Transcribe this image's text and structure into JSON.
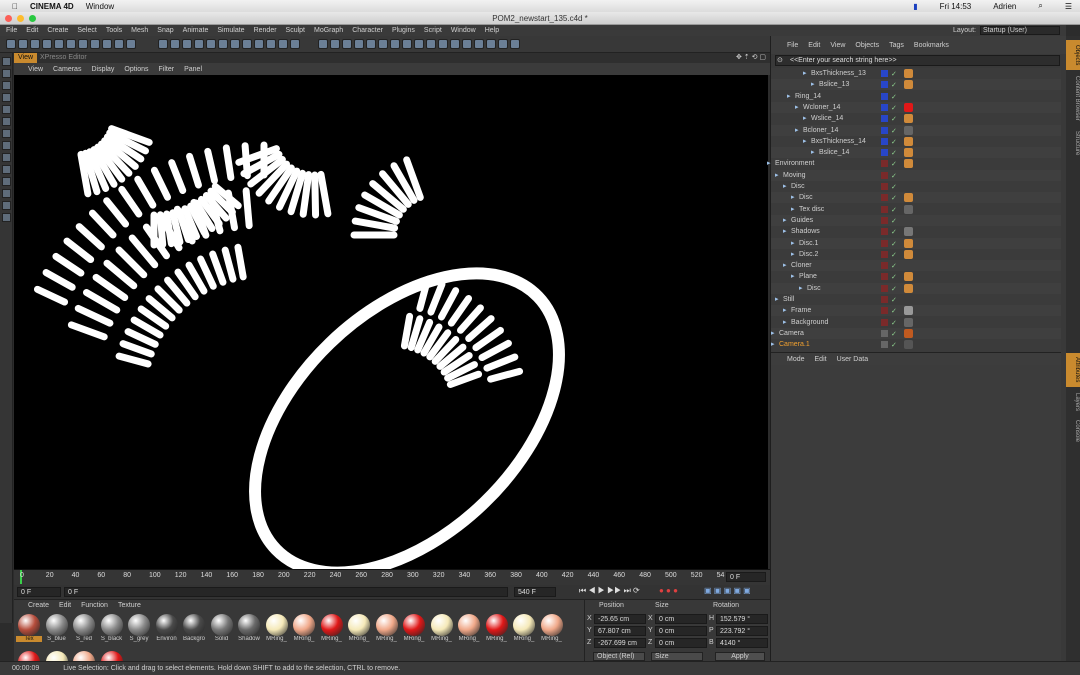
{
  "mac": {
    "app_name": "CINEMA 4D",
    "window_menu": "Window",
    "clock": "Fri 14:53",
    "user": "Adrien"
  },
  "window_title": "POM2_newstart_135.c4d *",
  "menu": [
    "File",
    "Edit",
    "Create",
    "Select",
    "Tools",
    "Mesh",
    "Snap",
    "Animate",
    "Simulate",
    "Render",
    "Sculpt",
    "MoGraph",
    "Character",
    "Plugins",
    "Script",
    "Window",
    "Help"
  ],
  "layout": {
    "label": "Layout:",
    "value": "Startup (User)"
  },
  "viewport_tabs": [
    "View",
    "XPresso Editor"
  ],
  "viewport_menu": [
    "View",
    "Cameras",
    "Display",
    "Options",
    "Filter",
    "Panel"
  ],
  "timeline": {
    "ticks": [
      "0",
      "20",
      "40",
      "60",
      "80",
      "100",
      "120",
      "140",
      "160",
      "180",
      "200",
      "220",
      "240",
      "260",
      "280",
      "300",
      "320",
      "340",
      "360",
      "380",
      "400",
      "420",
      "440",
      "460",
      "480",
      "500",
      "520",
      "54"
    ],
    "end_field": "0 F"
  },
  "time_controls": {
    "start": "0 F",
    "current": "0 F",
    "end1": "540 F",
    "end2": "540 F"
  },
  "material_menu": [
    "Create",
    "Edit",
    "Function",
    "Texture"
  ],
  "materials": [
    {
      "name": "Tex",
      "color": "#b64d3c"
    },
    {
      "name": "S_blue",
      "color": "#8a8a8a"
    },
    {
      "name": "S_red",
      "color": "#8a8a8a"
    },
    {
      "name": "S_black",
      "color": "#8a8a8a"
    },
    {
      "name": "S_grey",
      "color": "#8a8a8a"
    },
    {
      "name": "Environ",
      "color": "#4a4a4a"
    },
    {
      "name": "Backgro",
      "color": "#4a4a4a"
    },
    {
      "name": "Solid",
      "color": "#777777"
    },
    {
      "name": "Shadow",
      "color": "#6a6a6a"
    },
    {
      "name": "MRing_",
      "color": "#f5e9b8"
    },
    {
      "name": "MRing_",
      "color": "#f0a889"
    },
    {
      "name": "MRing_",
      "color": "#e01818"
    },
    {
      "name": "MRing_",
      "color": "#f5e9b8"
    },
    {
      "name": "MRing_",
      "color": "#f0a889"
    },
    {
      "name": "MRing_",
      "color": "#e01818"
    },
    {
      "name": "MRing_",
      "color": "#f5e9b8"
    },
    {
      "name": "MRing_",
      "color": "#f0a889"
    },
    {
      "name": "MRing_",
      "color": "#e01818"
    },
    {
      "name": "MRing_",
      "color": "#f5e9b8"
    },
    {
      "name": "MRing_",
      "color": "#f0a889"
    }
  ],
  "coords": {
    "headers": [
      "Position",
      "Size",
      "Rotation"
    ],
    "rows": [
      {
        "a": "X",
        "pos": "-25.65 cm",
        "b": "X",
        "size": "0 cm",
        "c": "H",
        "rot": "152.579 °"
      },
      {
        "a": "Y",
        "pos": "67.807 cm",
        "b": "Y",
        "size": "0 cm",
        "c": "P",
        "rot": "223.792 °"
      },
      {
        "a": "Z",
        "pos": "-267.699 cm",
        "b": "Z",
        "size": "0 cm",
        "c": "B",
        "rot": "4140 °"
      }
    ],
    "mode": "Object (Rel)",
    "size_mode": "Size",
    "apply": "Apply"
  },
  "object_menu": [
    "File",
    "Edit",
    "View",
    "Objects",
    "Tags",
    "Bookmarks"
  ],
  "search_placeholder": "<<Enter your search string here>>",
  "objects": [
    {
      "name": "BxsThickness_13",
      "color": "#2846c8"
    },
    {
      "name": "Bslice_13",
      "color": "#2846c8"
    },
    {
      "name": "Ring_14",
      "color": "#2846c8"
    },
    {
      "name": "Wcloner_14",
      "color": "#2846c8"
    },
    {
      "name": "Wslice_14",
      "color": "#2846c8"
    },
    {
      "name": "Bcloner_14",
      "color": "#2846c8"
    },
    {
      "name": "BxsThickness_14",
      "color": "#2846c8"
    },
    {
      "name": "Bslice_14",
      "color": "#2846c8"
    },
    {
      "name": "Environment",
      "color": "#7a2a2a"
    },
    {
      "name": "Moving",
      "color": "#7a2a2a"
    },
    {
      "name": "Disc",
      "color": "#7a2a2a"
    },
    {
      "name": "Disc",
      "color": "#7a2a2a"
    },
    {
      "name": "Tex disc",
      "color": "#7a2a2a"
    },
    {
      "name": "Guides",
      "color": "#7a2a2a"
    },
    {
      "name": "Shadows",
      "color": "#7a2a2a"
    },
    {
      "name": "Disc.1",
      "color": "#7a2a2a"
    },
    {
      "name": "Disc.2",
      "color": "#7a2a2a"
    },
    {
      "name": "Cloner",
      "color": "#7a2a2a"
    },
    {
      "name": "Plane",
      "color": "#7a2a2a"
    },
    {
      "name": "Disc",
      "color": "#7a2a2a"
    },
    {
      "name": "Still",
      "color": "#7a2a2a"
    },
    {
      "name": "Frame",
      "color": "#7a2a2a"
    },
    {
      "name": "Background",
      "color": "#7a2a2a"
    },
    {
      "name": "Camera",
      "color": "#666666"
    },
    {
      "name": "Camera.1",
      "color": "#666666"
    }
  ],
  "attr_menu": [
    "Mode",
    "Edit",
    "User Data"
  ],
  "side_tabs_top": [
    "Objects",
    "Content Browser",
    "Structure"
  ],
  "side_tabs_bottom": [
    "Attributes",
    "Layers",
    "Console"
  ],
  "status": {
    "time": "00:00:09",
    "message": "Live Selection: Click and drag to select elements. Hold down SHIFT to add to the selection, CTRL to remove."
  }
}
